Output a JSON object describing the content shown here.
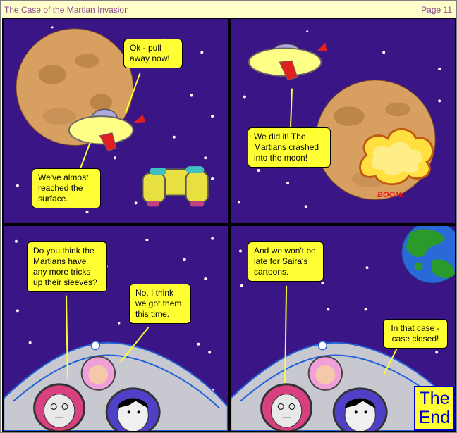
{
  "header": {
    "title": "The Case of the Martian Invasion",
    "page": "Page 11"
  },
  "panels": [
    {
      "bubbles": [
        {
          "text": "Ok - pull away now!"
        },
        {
          "text": "We've almost reached the surface."
        }
      ]
    },
    {
      "bubbles": [
        {
          "text": "We did it! The Martians crashed into the moon!"
        }
      ],
      "sound_effect": "BOOM!"
    },
    {
      "bubbles": [
        {
          "text": "Do you think the Martians have any more tricks up their sleeves?"
        },
        {
          "text": "No, I think we got them this time."
        }
      ]
    },
    {
      "bubbles": [
        {
          "text": "And we won't be late for Saira's cartoons."
        },
        {
          "text": "In that case - case closed!"
        }
      ],
      "end_label": {
        "line1": "The",
        "line2": "End"
      }
    }
  ],
  "colors": {
    "sky": "#3a1585",
    "bubble": "#ffff33",
    "moon": "#d8a060",
    "earth_land": "#2a9a2a",
    "earth_sea": "#2a6ad8"
  }
}
